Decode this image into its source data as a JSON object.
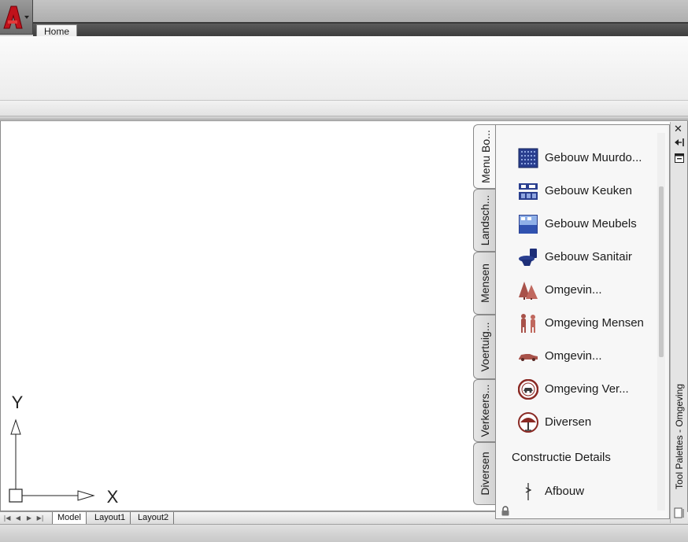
{
  "ribbon": {
    "tabs": [
      {
        "label": "Home",
        "active": true
      }
    ]
  },
  "drawing": {
    "ucs": {
      "x_label": "X",
      "y_label": "Y"
    }
  },
  "layout_tabs": {
    "items": [
      "Model",
      "Layout1",
      "Layout2"
    ],
    "active": "Model"
  },
  "tool_palette": {
    "title": "Tool Palettes - Omgeving",
    "tabs": [
      {
        "label": "Menu Bo...",
        "active": true
      },
      {
        "label": "Landsch...",
        "active": false
      },
      {
        "label": "Mensen",
        "active": false
      },
      {
        "label": "Voertuig...",
        "active": false
      },
      {
        "label": "Verkeers...",
        "active": false
      },
      {
        "label": "Diversen",
        "active": false
      }
    ],
    "items": [
      {
        "label": "Gebouw Muurdo...",
        "icon": "wall-panel-icon"
      },
      {
        "label": "Gebouw Keuken",
        "icon": "kitchen-icon"
      },
      {
        "label": "Gebouw Meubels",
        "icon": "furniture-icon"
      },
      {
        "label": "Gebouw Sanitair",
        "icon": "toilet-icon"
      },
      {
        "label": "Omgevin...",
        "icon": "trees-icon"
      },
      {
        "label": "Omgeving Mensen",
        "icon": "people-icon"
      },
      {
        "label": "Omgevin...",
        "icon": "car-icon"
      },
      {
        "label": "Omgeving Ver...",
        "icon": "traffic-sign-icon"
      },
      {
        "label": "Diversen",
        "icon": "umbrella-icon"
      }
    ],
    "section_header": "Constructie Details",
    "section_items": [
      {
        "label": "Afbouw",
        "icon": "detail-line-icon"
      }
    ]
  },
  "colors": {
    "building_icon": "#2a3f8f",
    "landscape_icon": "#a8524a"
  }
}
